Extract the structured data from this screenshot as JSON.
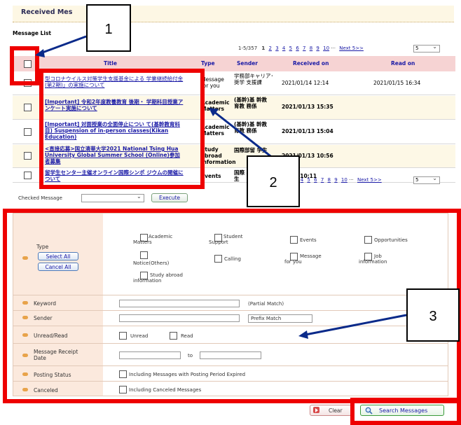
{
  "header": {
    "title": "Received Mes",
    "list_label": "Message List"
  },
  "pager": {
    "range": "1-5/357",
    "current": "1",
    "pages": [
      "2",
      "3",
      "4",
      "5",
      "6",
      "7",
      "8",
      "9",
      "10"
    ],
    "ellipsis": "···",
    "next": "Next 5>>",
    "per_page": "5"
  },
  "table": {
    "headers": {
      "title": "Title",
      "type": "Type",
      "sender": "Sender",
      "received": "Received on",
      "read": "Read on"
    },
    "rows": [
      {
        "title": "型コロナウイルス対策学生支援基金による 学業継続給付金(第2期)」の実施について",
        "type": "Message for you",
        "sender": "学務部キャリア･奨学 支援課",
        "received": "2021/01/14 12:14",
        "read": "2021/01/15 16:34"
      },
      {
        "title": "[Important] 令和2年度教養教育 後期・ 学期科目授業アンケート実施について",
        "type": "Academic Matters",
        "sender": "(基幹)基 幹教育教 務係",
        "received": "2021/01/13 15:35",
        "read": ""
      },
      {
        "title": "[Important] 対面授業の全面停止につい て(基幹教育科目) Suspension of in-person classes(Kikan Education)",
        "type": "Academic Matters",
        "sender": "(基幹)基 幹教育教 務係",
        "received": "2021/01/13 15:04",
        "read": ""
      },
      {
        "title": "<直接応募>国立清華大学2021 National Tsing Hua University Global Summer School (Online)参加者募集",
        "type": "Study abroad information",
        "sender": "国際部留 学生",
        "received": "2021/01/13 10:56",
        "read": ""
      },
      {
        "title": "留学生センター主催オンライン国際シンポ ジウムの開催について",
        "type": "Events",
        "sender": "国際 学生",
        "received": "01/13 10:11",
        "read": ""
      }
    ]
  },
  "checked": {
    "label": "Checked Message",
    "execute": "Execute"
  },
  "form": {
    "type_label": "Type",
    "select_all": "Select All",
    "cancel_all": "Cancel All",
    "options": [
      "Academic Matters",
      "Student Support",
      "Events",
      "Opportunities",
      "Notice(Others)",
      "Calling",
      "Message for you",
      "Job information",
      "Study abroad information"
    ],
    "keyword_label": "Keyword",
    "keyword_note": "(Partial Match)",
    "sender_label": "Sender",
    "sender_match": "Prefix Match",
    "unread_read_label": "Unread/Read",
    "unread": "Unread",
    "read": "Read",
    "receipt_label": "Message Receipt Date",
    "to": "to",
    "posting_label": "Posting Status",
    "posting_opt": "Including Messages with Posting Period Expired",
    "canceled_label": "Canceled",
    "canceled_opt": "Including Canceled Messages"
  },
  "buttons": {
    "clear": "Clear",
    "search": "Search Messages"
  },
  "callouts": {
    "one": "1",
    "two": "2",
    "three": "3"
  },
  "colors": {
    "annotation_red": "#ee0000",
    "link_blue": "#1a1aa6",
    "header_pink": "#f6d3d3"
  }
}
